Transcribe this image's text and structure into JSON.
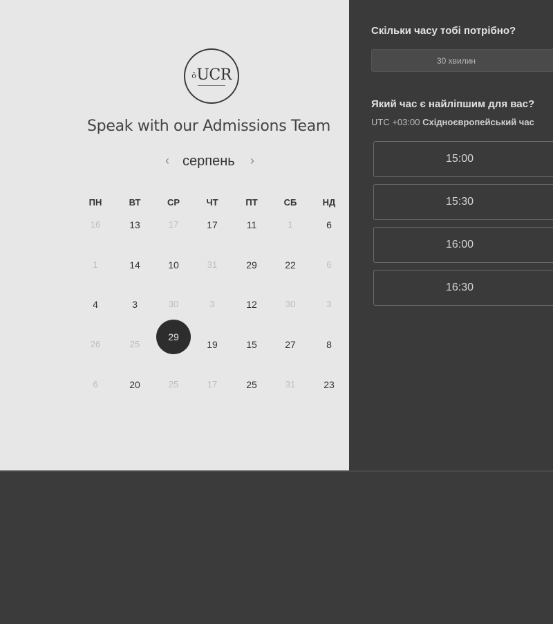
{
  "logo_text": "UCR",
  "logo_small": "ō",
  "title": "Speak with our Admissions Team",
  "calendar": {
    "month": "серпень",
    "prev_icon": "‹",
    "next_icon": "›",
    "weekdays": [
      "ПН",
      "ВТ",
      "СР",
      "ЧТ",
      "ПТ",
      "СБ",
      "НД"
    ],
    "weeks": [
      [
        "16",
        "13",
        "17",
        "17",
        "11",
        "1",
        "6"
      ],
      [
        "1",
        "14",
        "10",
        "31",
        "29",
        "22",
        "6"
      ],
      [
        "4",
        "3",
        "30",
        "3",
        "12",
        "30",
        "3"
      ],
      [
        "26",
        "25",
        "29",
        "19",
        "15",
        "27",
        "8"
      ],
      [
        "6",
        "20",
        "25",
        "17",
        "25",
        "31",
        "23"
      ]
    ],
    "selected_day": "29"
  },
  "booking": {
    "duration_question": "Скільки часу тобі потрібно?",
    "duration_value": "30 хвилин",
    "time_question": "Який час є найліпшим для вас?",
    "timezone_offset": "UTC +03:00",
    "timezone_name": "Східноєвропейський час",
    "slots": [
      "15:00",
      "15:30",
      "16:00",
      "16:30"
    ]
  }
}
